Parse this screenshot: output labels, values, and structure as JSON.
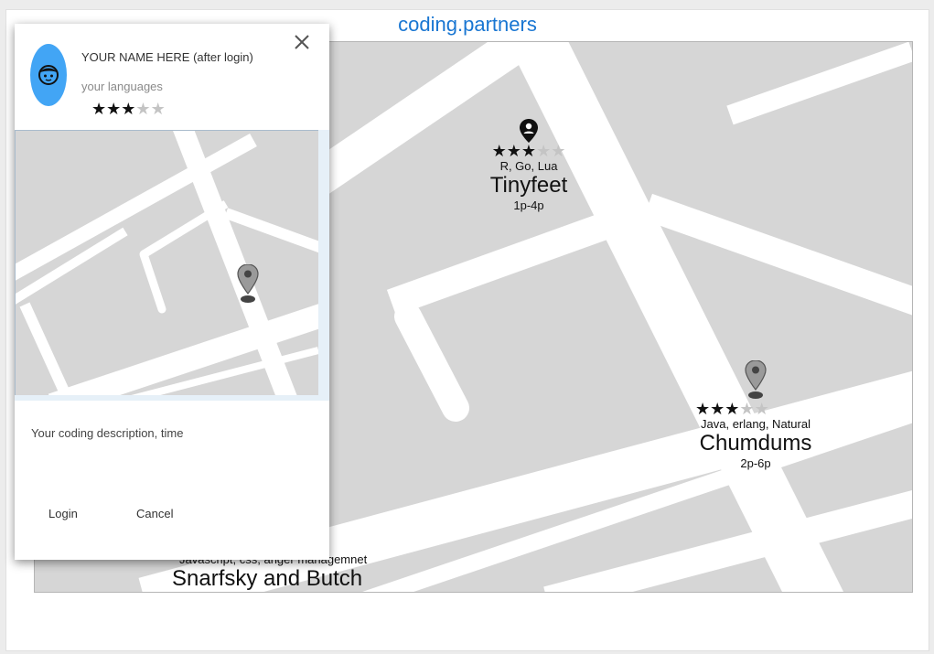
{
  "site": {
    "title": "coding.partners"
  },
  "markers": [
    {
      "languages": "R, Go, Lua",
      "name": "Tinyfeet",
      "time": "1p-4p",
      "rating": 3,
      "max_rating": 5,
      "pin": "person-pin-icon"
    },
    {
      "languages": "Java, erlang, Natural",
      "name": "Chumdums",
      "time": "2p-6p",
      "rating": 3,
      "max_rating": 5,
      "pin": "map-pin-icon"
    },
    {
      "languages": "Javascript, css, anger managemnet",
      "name": "Snarfsky and Butch"
    }
  ],
  "dialog": {
    "close_icon": "close-icon",
    "avatar_icon": "face-icon",
    "user_name": "YOUR NAME HERE (after login)",
    "languages_placeholder": "your languages",
    "rating": 3,
    "max_rating": 5,
    "description_placeholder": "Your coding description, time",
    "login_label": "Login",
    "cancel_label": "Cancel"
  },
  "colors": {
    "title": "#1976d2",
    "avatar_bg": "#42a5f5",
    "map_bg": "#d6d6d6",
    "street": "#ffffff"
  }
}
